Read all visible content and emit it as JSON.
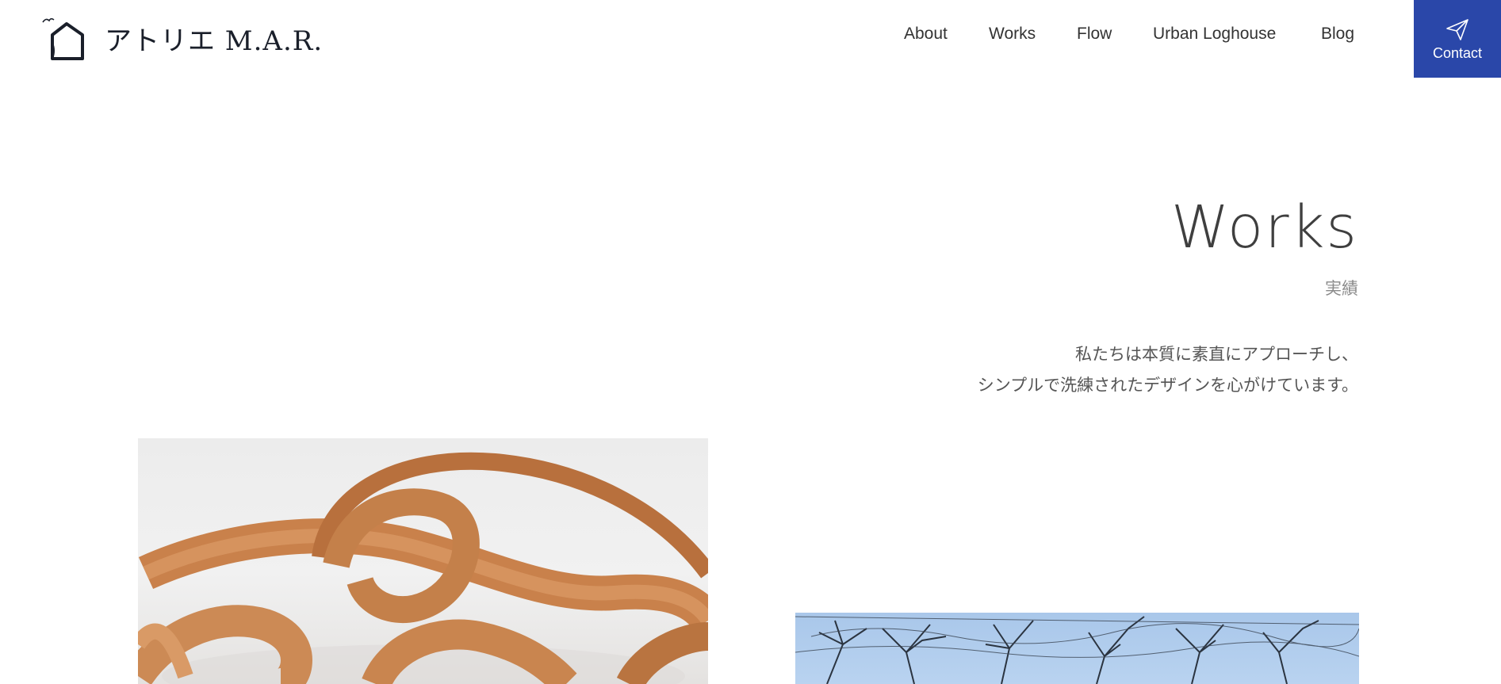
{
  "header": {
    "logo_text": "アトリエ M.A.R.",
    "nav": [
      {
        "label": "About"
      },
      {
        "label": "Works"
      },
      {
        "label": "Flow"
      },
      {
        "label": "Urban Loghouse"
      },
      {
        "label": "Blog"
      }
    ],
    "contact_label": "Contact",
    "contact_icon": "paper-plane-icon",
    "contact_color": "#2a47a9"
  },
  "section": {
    "title": "Works",
    "subtitle": "実績",
    "tagline_lines": [
      "私たちは本質に素直にアプローチし、",
      "シンプルで洗練されたデザインを心がけています。"
    ]
  },
  "works": [
    {
      "image": "bent-wood-ribbon-sculpture"
    },
    {
      "image": "bare-tree-branches-blue-sky"
    }
  ]
}
